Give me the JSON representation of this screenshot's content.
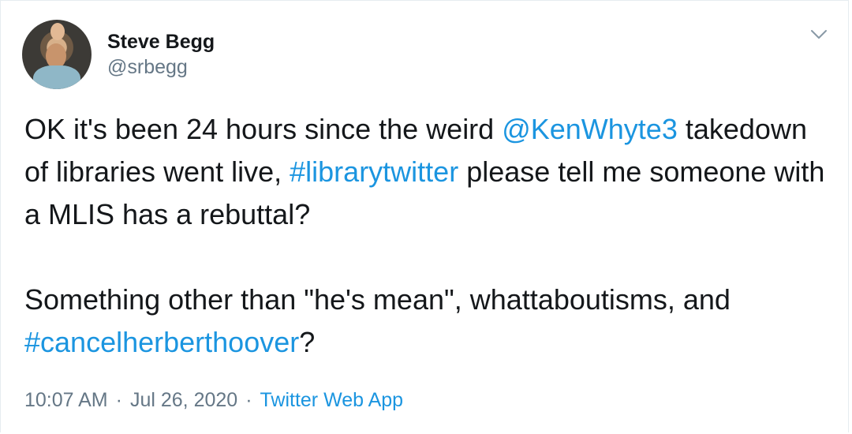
{
  "author": {
    "display_name": "Steve Begg",
    "handle": "@srbegg"
  },
  "tweet": {
    "para1": {
      "t1": "OK it's been 24 hours since the weird ",
      "mention": "@KenWhyte3",
      "t2": " takedown of libraries went live, ",
      "hashtag": "#librarytwitter",
      "t3": " please tell me someone with a MLIS has a rebuttal?"
    },
    "para2": {
      "t1": "Something other than \"he's mean\", whattaboutisms, and ",
      "hashtag": "#cancelherberthoover",
      "t2": "?"
    }
  },
  "meta": {
    "time": "10:07 AM",
    "date": "Jul 26, 2020",
    "separator": "·",
    "source": "Twitter Web App"
  },
  "icons": {
    "menu": "chevron-down-icon",
    "avatar": "avatar-photo"
  },
  "colors": {
    "link": "#1b95e0",
    "secondary_text": "#657786",
    "primary_text": "#14171a"
  }
}
